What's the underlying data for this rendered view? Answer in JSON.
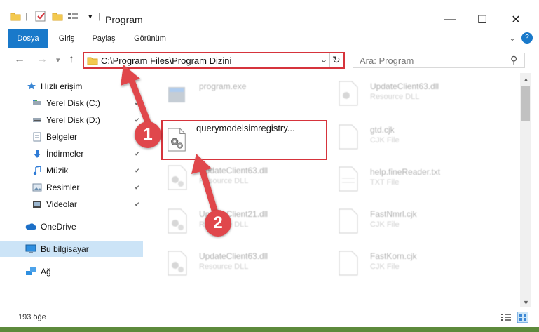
{
  "window": {
    "title": "Program",
    "min": "—",
    "max": "☐",
    "close": "✕"
  },
  "quick_access": {
    "dropdown": "▾"
  },
  "ribbon": {
    "tabs": [
      "Dosya",
      "Giriş",
      "Paylaş",
      "Görünüm"
    ],
    "expand": "⌄",
    "help": "?"
  },
  "nav": {
    "back": "←",
    "forward": "→",
    "recent": "▾",
    "up": "↑"
  },
  "address": {
    "path": "C:\\Program Files\\Program Dizini",
    "dropdown": "⌄",
    "refresh": "↻"
  },
  "search": {
    "placeholder": "Ara: Program",
    "icon": "⚲"
  },
  "sidebar": {
    "quick_access": "Hızlı erişim",
    "items": [
      {
        "label": "Yerel Disk (C:)",
        "icon": "drive-icon",
        "pinned": true
      },
      {
        "label": "Yerel Disk (D:)",
        "icon": "drive-icon",
        "pinned": true
      },
      {
        "label": "Belgeler",
        "icon": "documents-icon",
        "pinned": true
      },
      {
        "label": "İndirmeler",
        "icon": "downloads-icon",
        "pinned": true
      },
      {
        "label": "Müzik",
        "icon": "music-icon",
        "pinned": true
      },
      {
        "label": "Resimler",
        "icon": "pictures-icon",
        "pinned": true
      },
      {
        "label": "Videolar",
        "icon": "videos-icon",
        "pinned": true
      }
    ],
    "onedrive": "OneDrive",
    "this_pc": "Bu bilgisayar",
    "network": "Ağ",
    "pin_glyph": "📌"
  },
  "files": {
    "left": [
      {
        "name": "program.exe",
        "type": ""
      },
      {
        "name": "querymodelsimregistry...",
        "type": ""
      },
      {
        "name": "UpdateClient63.dll",
        "type": "Resource DLL"
      },
      {
        "name": "UpdateClient21.dll",
        "type": "Resource DLL"
      },
      {
        "name": "UpdateClient63.dll",
        "type": "Resource DLL"
      }
    ],
    "right": [
      {
        "name": "UpdateClient63.dll",
        "type": "Resource DLL"
      },
      {
        "name": "gtd.cjk",
        "type": "CJK File"
      },
      {
        "name": "help.fineReader.txt",
        "type": "TXT File"
      },
      {
        "name": "FastNmrl.cjk",
        "type": "CJK File"
      },
      {
        "name": "FastKorn.cjk",
        "type": "CJK File"
      }
    ]
  },
  "status": {
    "count": "193 öğe"
  },
  "annotations": {
    "badge1": "1",
    "badge2": "2",
    "color": "#e0474c"
  },
  "colors": {
    "accent": "#1979ca",
    "highlight": "#d6343c",
    "selected": "#cce4f7"
  }
}
